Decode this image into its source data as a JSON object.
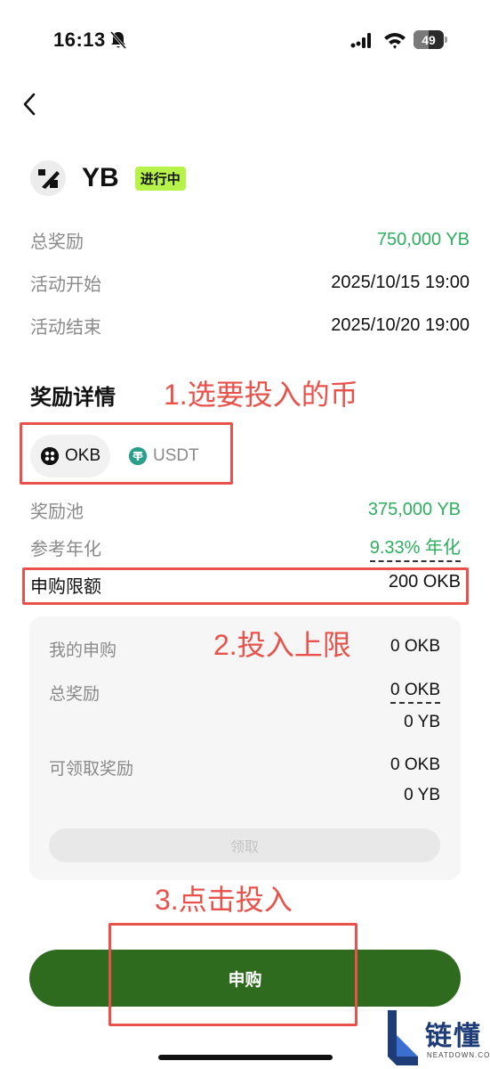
{
  "status_bar": {
    "time": "16:13",
    "battery_level": "49",
    "battery_fraction": 0.49
  },
  "coin": {
    "symbol": "YB",
    "status_badge": "进行中"
  },
  "info": {
    "total_reward_label": "总奖励",
    "total_reward_value": "750,000 YB",
    "start_label": "活动开始",
    "start_value": "2025/10/15 19:00",
    "end_label": "活动结束",
    "end_value": "2025/10/20 19:00"
  },
  "details": {
    "title": "奖励详情",
    "tabs": [
      {
        "label": "OKB",
        "selected": true
      },
      {
        "label": "USDT",
        "selected": false
      }
    ],
    "pool_label": "奖励池",
    "pool_value": "375,000 YB",
    "apr_label": "参考年化",
    "apr_value": "9.33% 年化",
    "limit_label": "申购限额",
    "limit_value": "200 OKB"
  },
  "card": {
    "my_subscription_label": "我的申购",
    "my_subscription_value": "0 OKB",
    "total_reward_label": "总奖励",
    "total_reward_okb": "0 OKB",
    "total_reward_yb": "0 YB",
    "claimable_label": "可领取奖励",
    "claimable_okb": "0 OKB",
    "claimable_yb": "0 YB",
    "claim_button": "领取"
  },
  "subscribe_button": "申购",
  "annotations": {
    "step1": "1.选要投入的币",
    "step2": "2.投入上限",
    "step3": "3.点击投入"
  },
  "watermark": {
    "cn": "链懂",
    "en": "NEATDOWN.COM"
  },
  "colors": {
    "accent_green": "#2fae5f",
    "button_green": "#2f6b1f",
    "badge_green": "#b6f24a",
    "annotation_red": "#e8524a"
  }
}
